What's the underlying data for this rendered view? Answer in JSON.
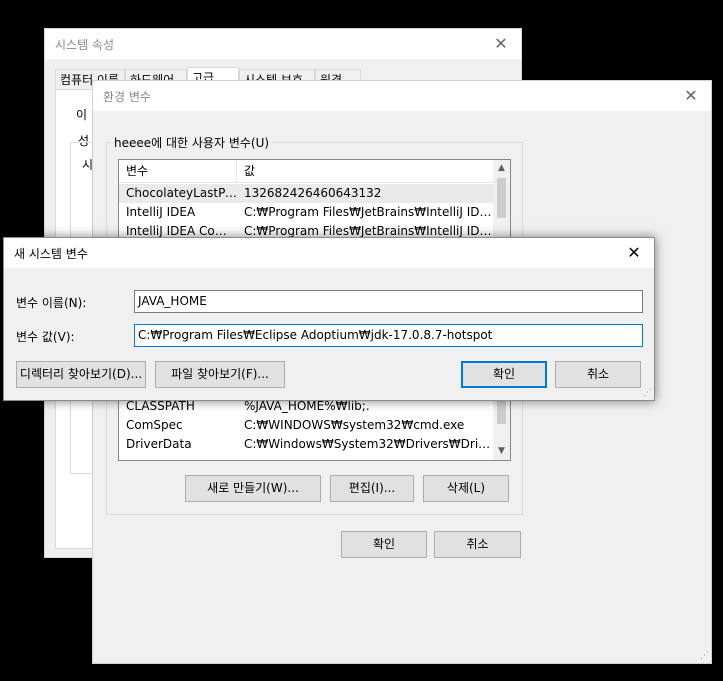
{
  "system_properties": {
    "title": "시스템 속성",
    "tabs": [
      "컴퓨터 이름",
      "하드웨어",
      "고급",
      "시스템 보호",
      "원격"
    ],
    "panel_fragments": [
      "이 ",
      "성",
      "시"
    ]
  },
  "env_vars": {
    "title": "환경 변수",
    "user_group_label": "heeee에 대한 사용자 변수(U)",
    "columns": [
      "변수",
      "값"
    ],
    "user_rows": [
      {
        "name": "ChocolateyLastPat...",
        "value": "132682426460643132"
      },
      {
        "name": "IntelliJ IDEA",
        "value": "C:₩Program Files₩JetBrains₩IntelliJ IDEA 2..."
      },
      {
        "name": "IntelliJ IDEA Com...",
        "value": "C:₩Program Files₩JetBrains₩IntelliJ IDEA C..."
      }
    ],
    "system_rows": [
      {
        "name": "CLASSPATH",
        "value": "%JAVA_HOME%₩lib;."
      },
      {
        "name": "ComSpec",
        "value": "C:₩WINDOWS₩system32₩cmd.exe"
      },
      {
        "name": "DriverData",
        "value": "C:₩Windows₩System32₩Drivers₩DriverData"
      }
    ],
    "buttons": {
      "new": "새로 만들기(W)...",
      "edit": "편집(I)...",
      "delete": "삭제(L)"
    },
    "ok": "확인",
    "cancel": "취소"
  },
  "new_var_dialog": {
    "title": "새 시스템 변수",
    "name_label": "변수 이름(N):",
    "name_value": "JAVA_HOME",
    "value_label": "변수 값(V):",
    "value_value": "C:₩Program Files₩Eclipse Adoptium₩jdk-17.0.8.7-hotspot",
    "browse_dir": "디렉터리 찾아보기(D)...",
    "browse_file": "파일 찾아보기(F)...",
    "ok": "확인",
    "cancel": "취소"
  },
  "icons": {
    "close": "close-icon",
    "scroll_up": "scroll-up-icon",
    "scroll_down": "scroll-down-icon",
    "resize": "resize-grip-icon"
  },
  "colors": {
    "focus_border": "#0078d7",
    "window_bg": "#f0f0f0",
    "desktop": "#000000"
  }
}
